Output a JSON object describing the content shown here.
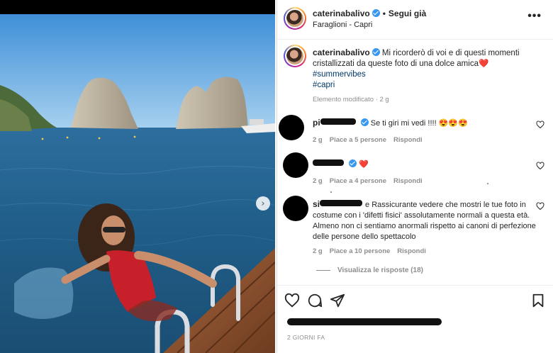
{
  "post": {
    "username": "caterinabalivo",
    "follow_label": "Segui già",
    "location": "Faraglioni - Capri",
    "more_label": "•••",
    "caption_text": "Mi ricorderò di voi e di questi momenti cristallizzati da queste foto di una dolce amica❤️",
    "hashtags": [
      "#summervibes",
      "#capri"
    ],
    "edited_label": "Elemento modificato · 2 g",
    "date_label": "2 GIORNI FA"
  },
  "comments": [
    {
      "author_visible": "pi",
      "text": "Se ti giri mi vedi !!!! 😍😍😍",
      "time": "2 g",
      "likes": "Piace a 5 persone",
      "reply": "Rispondi"
    },
    {
      "author_visible": "",
      "text": "❤️",
      "time": "2 g",
      "likes": "Piace a 4 persone",
      "reply": "Rispondi"
    },
    {
      "author_visible": "si",
      "text": "e Rassicurante vedere che mostri le tue foto in costume con i 'difetti fisici' assolutamente normali a questa età. Almeno non ci sentiamo anormali rispetto ai canoni di perfezione delle persone dello spettacolo",
      "time": "2 g",
      "likes": "Piace a 10 persone",
      "reply": "Rispondi"
    }
  ],
  "view_replies": "Visualizza le risposte (18)",
  "icons": {
    "like": "heart-icon",
    "comment": "comment-icon",
    "share": "paper-plane-icon",
    "save": "bookmark-icon",
    "carousel_next": "chevron-right-icon"
  },
  "colors": {
    "verified": "#3897f0",
    "hashtag": "#00376b",
    "muted": "#8e8e8e"
  }
}
